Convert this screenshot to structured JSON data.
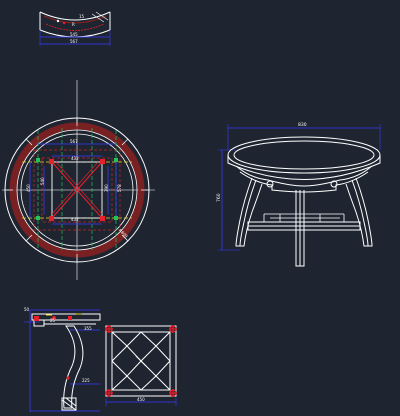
{
  "drawing": {
    "background": "#1e2530",
    "colors": {
      "outline": "#ffffff",
      "dimension": "#3a3aff",
      "red": "#e8202a",
      "green": "#22c35a",
      "yellow": "#e8d820",
      "dashed_red": "#cc2222"
    }
  },
  "arc_segment": {
    "dims": [
      "545",
      "567"
    ],
    "labels": [
      "15",
      "R"
    ]
  },
  "plan_view": {
    "top_dims": [
      "567",
      "432"
    ],
    "bottom_dims": [
      "432"
    ],
    "left_dims": [
      "450",
      "540"
    ],
    "right_dims": [
      "390",
      "578",
      "R800"
    ]
  },
  "elevation": {
    "width_dim": "830",
    "height_dim": "760"
  },
  "section": {
    "dims": [
      "50",
      "25",
      "355",
      "225"
    ]
  },
  "frame_view": {
    "bottom_dim": "450"
  }
}
